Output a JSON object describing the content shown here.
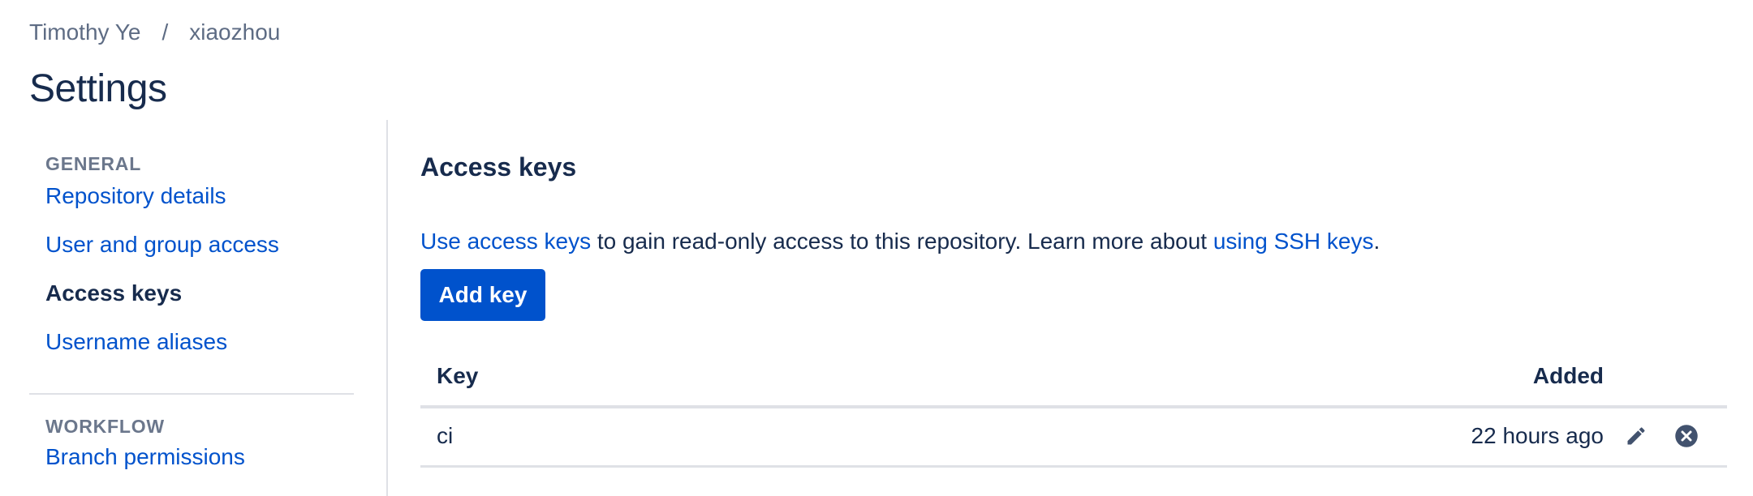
{
  "breadcrumb": {
    "project": "Timothy Ye",
    "separator": "/",
    "repository": "xiaozhou"
  },
  "page_title": "Settings",
  "sidebar": {
    "general_heading": "GENERAL",
    "items": [
      {
        "label": "Repository details",
        "active": false
      },
      {
        "label": "User and group access",
        "active": false
      },
      {
        "label": "Access keys",
        "active": true
      },
      {
        "label": "Username aliases",
        "active": false
      }
    ],
    "workflow_heading": "WORKFLOW",
    "workflow_items": [
      {
        "label": "Branch permissions",
        "active": false
      }
    ]
  },
  "main": {
    "title": "Access keys",
    "description": {
      "link1": "Use access keys",
      "text1": " to gain read-only access to this repository. Learn more about ",
      "link2": "using SSH keys",
      "text2": "."
    },
    "add_button": "Add key",
    "table": {
      "columns": {
        "key": "Key",
        "added": "Added"
      },
      "rows": [
        {
          "key": "ci",
          "added": "22 hours ago"
        }
      ]
    }
  },
  "icons": {
    "edit": "pencil-icon",
    "delete": "close-circle-icon"
  },
  "colors": {
    "link": "#0052cc",
    "text": "#172b4d",
    "muted": "#6b778c",
    "button_bg": "#0052cc",
    "border": "#dfe1e6",
    "icon": "#42526e"
  }
}
